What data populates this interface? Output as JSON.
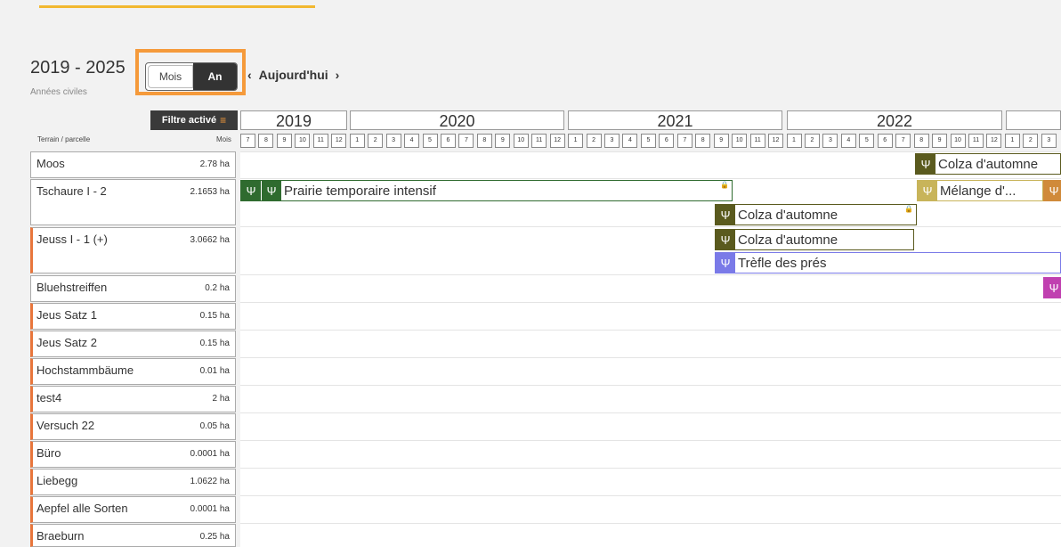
{
  "header": {
    "range": "2019 - 2025",
    "subtitle": "Années civiles",
    "toggle_month": "Mois",
    "toggle_year": "An",
    "prev_icon": "‹",
    "today": "Aujourd'hui",
    "next_icon": "›"
  },
  "filter": {
    "label": "Filtre activé",
    "icon": "filter-icon"
  },
  "columns": {
    "parcel": "Terrain / parcelle",
    "months": "Mois"
  },
  "timeline": {
    "years": [
      "2019",
      "2020",
      "2021",
      "2022"
    ],
    "months": [
      "7",
      "8",
      "9",
      "10",
      "11",
      "12",
      "1",
      "2",
      "3",
      "4",
      "5",
      "6",
      "7",
      "8",
      "9",
      "10",
      "11",
      "12",
      "1",
      "2",
      "3",
      "4",
      "5",
      "6",
      "7",
      "8",
      "9",
      "10",
      "11",
      "12",
      "1",
      "2",
      "3",
      "4",
      "5",
      "6",
      "7",
      "8",
      "9",
      "10",
      "11",
      "12",
      "1",
      "2",
      "3"
    ]
  },
  "parcels": [
    {
      "name": "Moos",
      "area": "2.78 ha"
    },
    {
      "name": "Tschaure I - 2",
      "area": "2.1653 ha"
    },
    {
      "name": "Jeuss I - 1 (+)",
      "area": "3.0662 ha"
    },
    {
      "name": "Bluehstreiffen",
      "area": "0.2 ha"
    },
    {
      "name": "Jeus Satz 1",
      "area": "0.15 ha"
    },
    {
      "name": "Jeus Satz 2",
      "area": "0.15 ha"
    },
    {
      "name": "Hochstammbäume",
      "area": "0.01 ha"
    },
    {
      "name": "test4",
      "area": "2 ha"
    },
    {
      "name": "Versuch 22",
      "area": "0.05 ha"
    },
    {
      "name": "Büro",
      "area": "0.0001 ha"
    },
    {
      "name": "Liebegg",
      "area": "1.0622 ha"
    },
    {
      "name": "Aepfel alle Sorten",
      "area": "0.0001 ha"
    },
    {
      "name": "Braeburn",
      "area": "0.25 ha"
    }
  ],
  "crops": [
    {
      "label": "Colza d'automne",
      "color": "#5a5a1e"
    },
    {
      "label": "Prairie temporaire intensif",
      "color": "#2f6b2f"
    },
    {
      "label": "Mélange d'...",
      "color": "#c8b45a"
    },
    {
      "label": "Colza d'automne",
      "color": "#5a5a1e"
    },
    {
      "label": "Colza d'automne",
      "color": "#5a5a1e"
    },
    {
      "label": "Trèfle des prés",
      "color": "#7a7ae8"
    },
    {
      "label": "",
      "color": "#c040b0"
    }
  ],
  "colors": {
    "accent": "#f59a3b",
    "dark": "#333333"
  }
}
